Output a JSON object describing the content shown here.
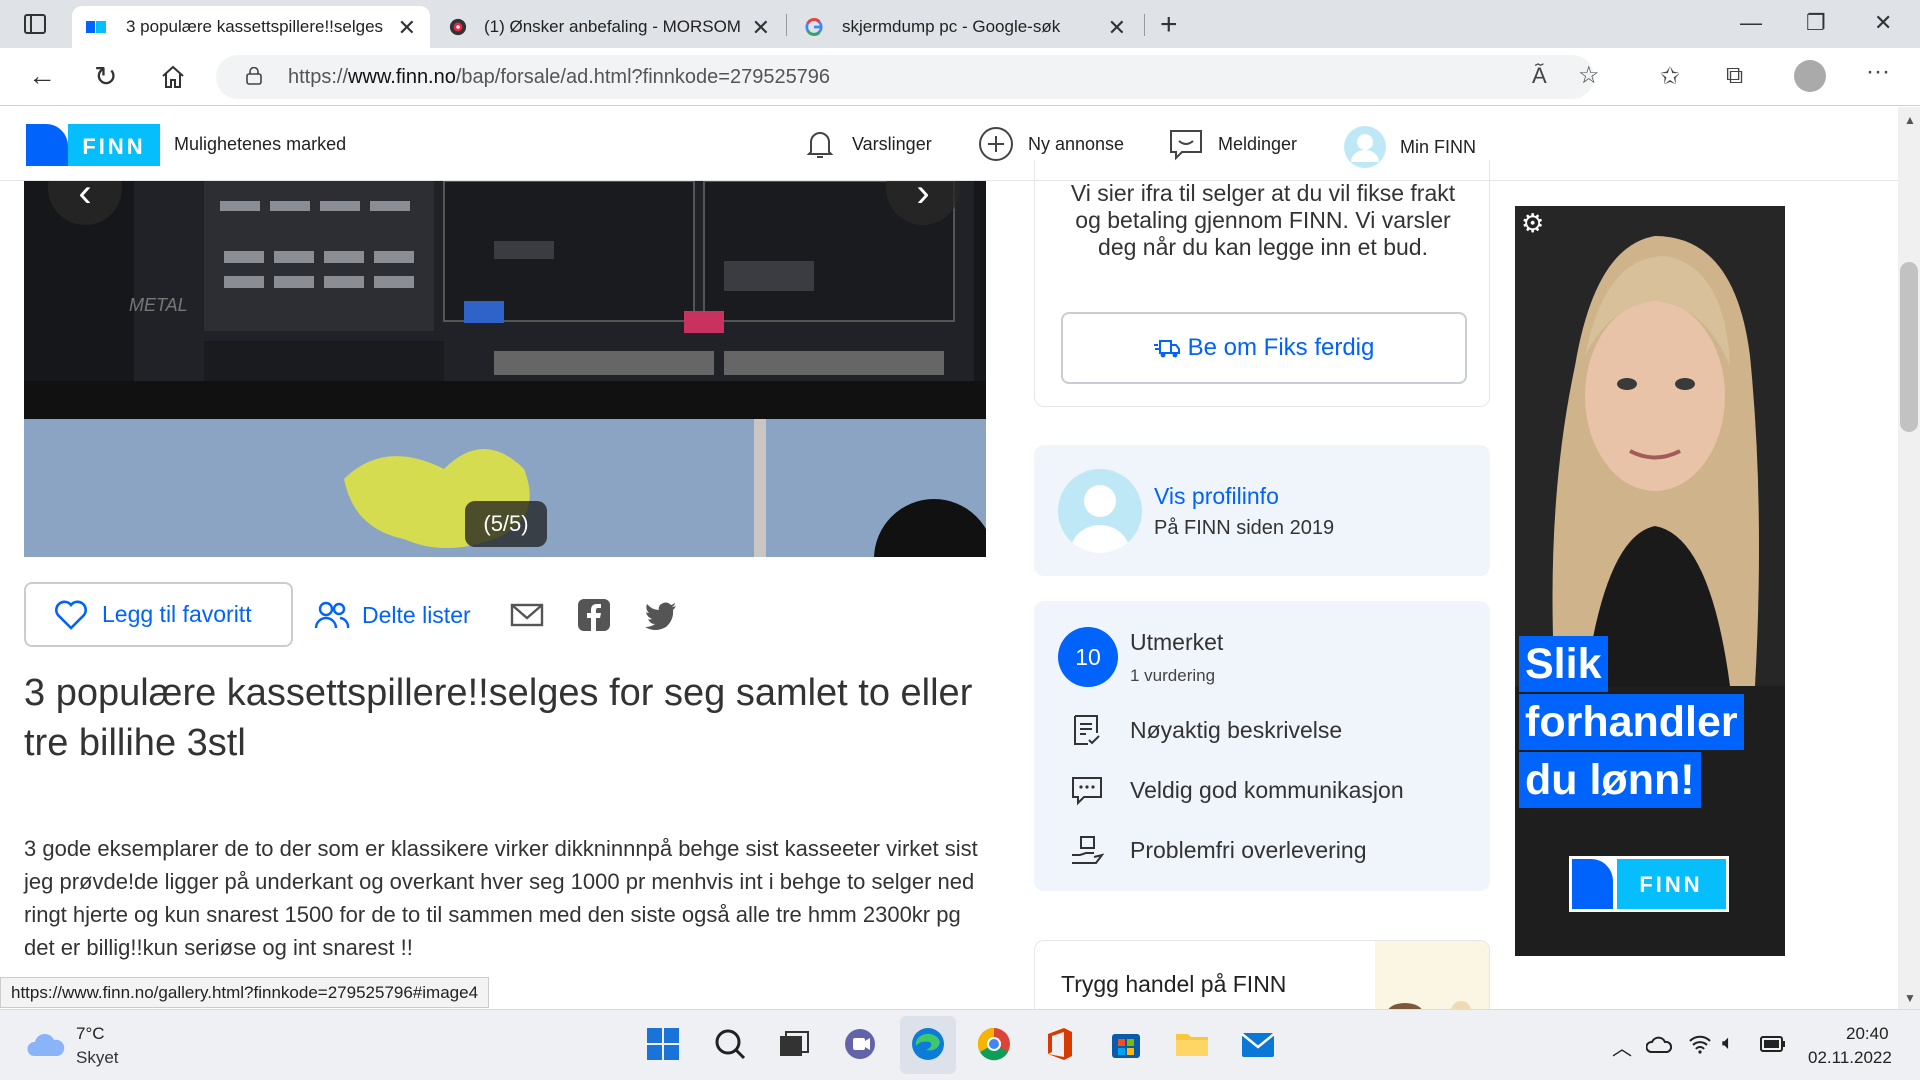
{
  "browser": {
    "tabs": [
      {
        "label": "3 populære kassettspillere!!selges",
        "active": true
      },
      {
        "label": "(1) Ønsker anbefaling - MORSOM",
        "active": false
      },
      {
        "label": "skjermdump pc - Google-søk",
        "active": false
      }
    ],
    "url_prefix": "https://",
    "url_host": "www.finn.no",
    "url_path": "/bap/forsale/ad.html?finnkode=279525796",
    "status_url": "https://www.finn.no/gallery.html?finnkode=279525796#image4"
  },
  "header": {
    "logo_text": "FINN",
    "tagline": "Mulighetenes marked",
    "nav": [
      "Varslinger",
      "Ny annonse",
      "Meldinger",
      "Min FINN"
    ]
  },
  "gallery": {
    "counter": "(5/5)",
    "prev_icon": "chevron-left-icon",
    "next_icon": "chevron-right-icon"
  },
  "actions": {
    "favorite": "Legg til favoritt",
    "shared_lists": "Delte lister"
  },
  "ad": {
    "title": "3 populære kassettspillere!!selges for seg samlet to eller tre billihe 3stl",
    "description": "3 gode eksemplarer de to der som er klassikere virker dikkninnnpå behge sist kasseeter virket sist jeg prøvde!de ligger på underkant og overkant hver seg 1000 pr menhvis int i behge to selger ned ringt hjerte og kun snarest 1500 for de to til sammen med den siste også alle tre hmm 2300kr pg det er billig!!kun seriøse og int snarest !!"
  },
  "fiks": {
    "text": "Vi sier ifra til selger at du vil fikse frakt og betaling gjennom FINN. Vi varsler deg når du kan legge inn et bud.",
    "button": "Be om Fiks ferdig"
  },
  "seller": {
    "profile_link": "Vis profilinfo",
    "member_since": "På FINN siden 2019"
  },
  "rating": {
    "score": "10",
    "label": "Utmerket",
    "count": "1 vurdering",
    "items": [
      "Nøyaktig beskrivelse",
      "Veldig god kommunikasjon",
      "Problemfri overlevering"
    ]
  },
  "trygg": {
    "title": "Trygg handel på FINN"
  },
  "banner": {
    "lines": [
      "Slik",
      "forhandler",
      "du lønn!"
    ],
    "logo_text": "FINN"
  },
  "taskbar": {
    "temperature": "7°C",
    "weather": "Skyet",
    "time": "20:40",
    "date": "02.11.2022"
  },
  "colors": {
    "finn_blue": "#0063fb",
    "panel_bg": "#f0f5fc"
  }
}
